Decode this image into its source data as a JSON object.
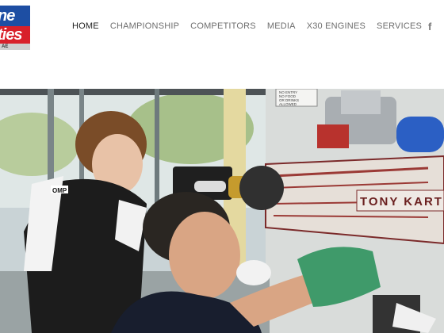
{
  "logo": {
    "line1": "ne",
    "line2": "ties",
    "line3": "AE"
  },
  "nav": [
    {
      "label": "HOME",
      "active": true
    },
    {
      "label": "CHAMPIONSHIP",
      "active": false
    },
    {
      "label": "COMPETITORS",
      "active": false
    },
    {
      "label": "MEDIA",
      "active": false
    },
    {
      "label": "X30 ENGINES",
      "active": false
    },
    {
      "label": "SERVICES",
      "active": false
    }
  ],
  "social": {
    "facebook": "f"
  },
  "hero": {
    "sign": "NO ENTRY\nNO FOOD\nOR DRINKS\nALLOWED",
    "suit_brand": "OMP",
    "kart_brand": "TONY KART",
    "brand_color_blue": "#1d4ea3",
    "brand_color_red": "#d8202a"
  }
}
